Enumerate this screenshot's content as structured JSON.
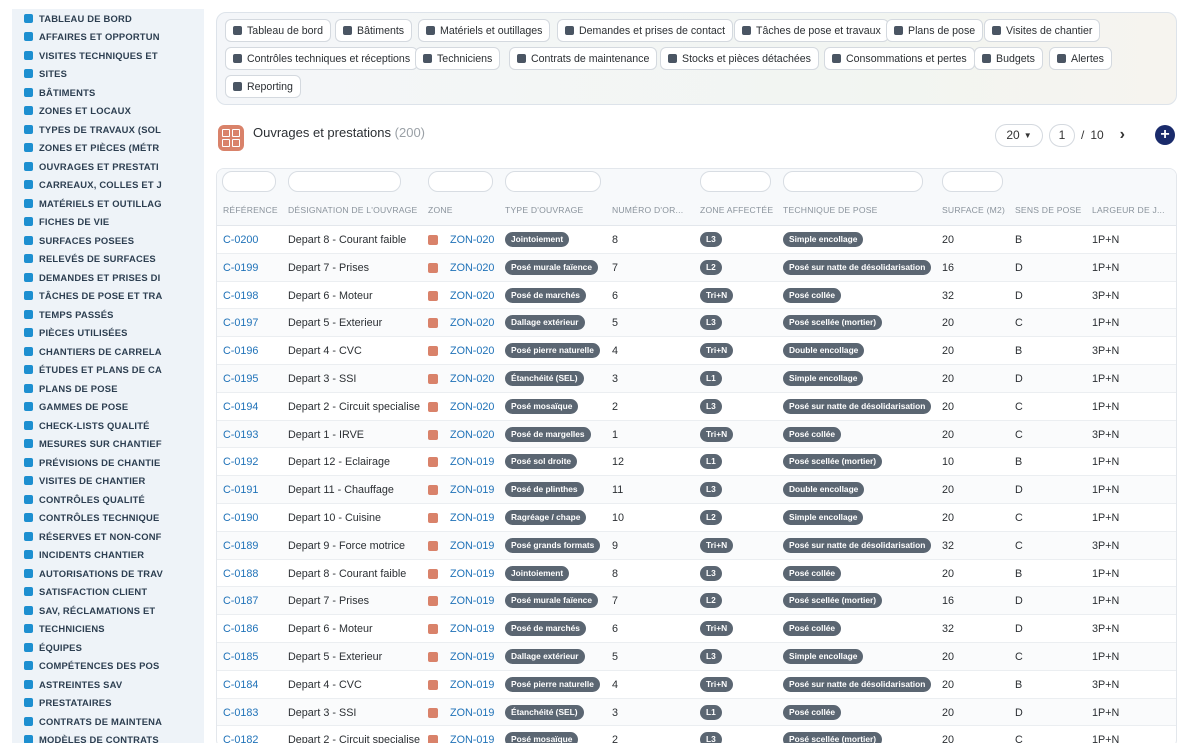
{
  "sidebar": {
    "items": [
      "TABLEAU DE BORD",
      "AFFAIRES ET OPPORTUN",
      "VISITES TECHNIQUES ET",
      "SITES",
      "BÂTIMENTS",
      "ZONES ET LOCAUX",
      "TYPES DE TRAVAUX (SOL",
      "ZONES ET PIÈCES (MÉTR",
      "OUVRAGES ET PRESTATI",
      "CARREAUX, COLLES ET J",
      "MATÉRIELS ET OUTILLAG",
      "FICHES DE VIE",
      "SURFACES POSEES",
      "RELEVÉS DE SURFACES",
      "DEMANDES ET PRISES DI",
      "TÂCHES DE POSE ET TRA",
      "TEMPS PASSÉS",
      "PIÈCES UTILISÉES",
      "CHANTIERS DE CARRELA",
      "ÉTUDES ET PLANS DE CA",
      "PLANS DE POSE",
      "GAMMES DE POSE",
      "CHECK-LISTS QUALITÉ",
      "MESURES SUR CHANTIEF",
      "PRÉVISIONS DE CHANTIE",
      "VISITES DE CHANTIER",
      "CONTRÔLES QUALITÉ",
      "CONTRÔLES TECHNIQUE",
      "RÉSERVES ET NON-CONF",
      "INCIDENTS CHANTIER",
      "AUTORISATIONS DE TRAV",
      "SATISFACTION CLIENT",
      "SAV, RÉCLAMATIONS ET",
      "TECHNICIENS",
      "ÉQUIPES",
      "COMPÉTENCES DES POS",
      "ASTREINTES SAV",
      "PRESTATAIRES",
      "CONTRATS DE MAINTENA",
      "MODÈLES DE CONTRATS"
    ]
  },
  "toolbar": {
    "buttons": [
      "Tableau de bord",
      "Bâtiments",
      "Matériels et outillages",
      "Demandes et prises de contact",
      "Tâches de pose et travaux",
      "Plans de pose",
      "Visites de chantier",
      "Contrôles techniques et réceptions",
      "Techniciens",
      "Contrats de maintenance",
      "Stocks et pièces détachées",
      "Consommations et pertes",
      "Budgets",
      "Alertes",
      "Reporting"
    ]
  },
  "header": {
    "title": "Ouvrages et prestations",
    "count": "(200)",
    "page_size": "20",
    "page": "1",
    "page_sep": "/",
    "total_pages": "10",
    "next": "›",
    "add": "+"
  },
  "table": {
    "columns": [
      "RÉFÉRENCE",
      "DÉSIGNATION DE L'OUVRAGE",
      "ZONE",
      "TYPE D'OUVRAGE",
      "NUMÉRO D'OR...",
      "ZONE AFFECTÉE",
      "TECHNIQUE DE POSE",
      "SURFACE (M2)",
      "SENS DE POSE",
      "LARGEUR DE J..."
    ],
    "rows": [
      [
        "C-0200",
        "Depart 8 - Courant faible",
        "ZON-020",
        "Jointoiement",
        "8",
        "L3",
        "Simple encollage",
        "20",
        "B",
        "1P+N"
      ],
      [
        "C-0199",
        "Depart 7 - Prises",
        "ZON-020",
        "Posé murale faïence",
        "7",
        "L2",
        "Posé sur natte de désolidarisation",
        "16",
        "D",
        "1P+N"
      ],
      [
        "C-0198",
        "Depart 6 - Moteur",
        "ZON-020",
        "Posé de marchés",
        "6",
        "Tri+N",
        "Posé collée",
        "32",
        "D",
        "3P+N"
      ],
      [
        "C-0197",
        "Depart 5 - Exterieur",
        "ZON-020",
        "Dallage extérieur",
        "5",
        "L3",
        "Posé scellée (mortier)",
        "20",
        "C",
        "1P+N"
      ],
      [
        "C-0196",
        "Depart 4 - CVC",
        "ZON-020",
        "Posé pierre naturelle",
        "4",
        "Tri+N",
        "Double encollage",
        "20",
        "B",
        "3P+N"
      ],
      [
        "C-0195",
        "Depart 3 - SSI",
        "ZON-020",
        "Étanchéité (SEL)",
        "3",
        "L1",
        "Simple encollage",
        "20",
        "D",
        "1P+N"
      ],
      [
        "C-0194",
        "Depart 2 - Circuit specialise",
        "ZON-020",
        "Posé mosaïque",
        "2",
        "L3",
        "Posé sur natte de désolidarisation",
        "20",
        "C",
        "1P+N"
      ],
      [
        "C-0193",
        "Depart 1 - IRVE",
        "ZON-020",
        "Posé de margelles",
        "1",
        "Tri+N",
        "Posé collée",
        "20",
        "C",
        "3P+N"
      ],
      [
        "C-0192",
        "Depart 12 - Eclairage",
        "ZON-019",
        "Posé sol droite",
        "12",
        "L1",
        "Posé scellée (mortier)",
        "10",
        "B",
        "1P+N"
      ],
      [
        "C-0191",
        "Depart 11 - Chauffage",
        "ZON-019",
        "Posé de plinthes",
        "11",
        "L3",
        "Double encollage",
        "20",
        "D",
        "1P+N"
      ],
      [
        "C-0190",
        "Depart 10 - Cuisine",
        "ZON-019",
        "Ragréage / chape",
        "10",
        "L2",
        "Simple encollage",
        "20",
        "C",
        "1P+N"
      ],
      [
        "C-0189",
        "Depart 9 - Force motrice",
        "ZON-019",
        "Posé grands formats",
        "9",
        "Tri+N",
        "Posé sur natte de désolidarisation",
        "32",
        "C",
        "3P+N"
      ],
      [
        "C-0188",
        "Depart 8 - Courant faible",
        "ZON-019",
        "Jointoiement",
        "8",
        "L3",
        "Posé collée",
        "20",
        "B",
        "1P+N"
      ],
      [
        "C-0187",
        "Depart 7 - Prises",
        "ZON-019",
        "Posé murale faïence",
        "7",
        "L2",
        "Posé scellée (mortier)",
        "16",
        "D",
        "1P+N"
      ],
      [
        "C-0186",
        "Depart 6 - Moteur",
        "ZON-019",
        "Posé de marchés",
        "6",
        "Tri+N",
        "Posé collée",
        "32",
        "D",
        "3P+N"
      ],
      [
        "C-0185",
        "Depart 5 - Exterieur",
        "ZON-019",
        "Dallage extérieur",
        "5",
        "L3",
        "Simple encollage",
        "20",
        "C",
        "1P+N"
      ],
      [
        "C-0184",
        "Depart 4 - CVC",
        "ZON-019",
        "Posé pierre naturelle",
        "4",
        "Tri+N",
        "Posé sur natte de désolidarisation",
        "20",
        "B",
        "3P+N"
      ],
      [
        "C-0183",
        "Depart 3 - SSI",
        "ZON-019",
        "Étanchéité (SEL)",
        "3",
        "L1",
        "Posé collée",
        "20",
        "D",
        "1P+N"
      ],
      [
        "C-0182",
        "Depart 2 - Circuit specialise",
        "ZON-019",
        "Posé mosaïque",
        "2",
        "L3",
        "Posé scellée (mortier)",
        "20",
        "C",
        "1P+N"
      ]
    ]
  },
  "colors": {
    "accent": "#1d8fd0",
    "link": "#1f72b8",
    "pill": "#5b6672",
    "zone_icon": "#d9826a",
    "add_button": "#1a2b6b"
  }
}
